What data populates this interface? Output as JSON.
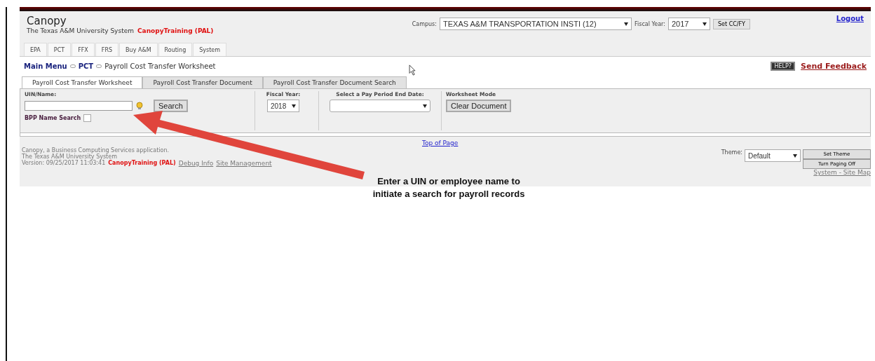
{
  "header": {
    "title": "Canopy",
    "org": "The Texas A&M University System",
    "environment": "CanopyTraining (PAL)",
    "campus": {
      "label": "Campus:",
      "value": "TEXAS A&M TRANSPORTATION INSTI (12)"
    },
    "fiscal_year": {
      "label": "Fiscal Year:",
      "value": "2017"
    },
    "set_button": "Set CC/FY",
    "logout": "Logout"
  },
  "nav_tabs": [
    {
      "label": "EPA"
    },
    {
      "label": "PCT"
    },
    {
      "label": "FFX"
    },
    {
      "label": "FRS"
    },
    {
      "label": "Buy A&M"
    },
    {
      "label": "Routing"
    },
    {
      "label": "System"
    }
  ],
  "breadcrumb": [
    {
      "label": "Main Menu",
      "kind": "link"
    },
    {
      "label": "PCT",
      "kind": "link"
    },
    {
      "label": "Payroll Cost Transfer Worksheet",
      "kind": "current"
    }
  ],
  "help_button": "HELP?",
  "feedback": "Send Feedback",
  "subtabs": [
    {
      "label": "Payroll Cost Transfer Worksheet",
      "selected": true
    },
    {
      "label": "Payroll Cost Transfer Document",
      "selected": false
    },
    {
      "label": "Payroll Cost Transfer Document Search",
      "selected": false
    }
  ],
  "form": {
    "uin_label": "UIN/Name:",
    "search_button": "Search",
    "bpp": {
      "label": "BPP Name Search",
      "checked": false
    },
    "fiscal_year": {
      "label": "Fiscal Year:",
      "value": "2018"
    },
    "pay_period": {
      "label": "Select a Pay Period End Date:"
    },
    "mode": {
      "label": "Worksheet Mode",
      "button": "Clear Document"
    }
  },
  "footer": {
    "line_1": "Canopy, a Business Computing Services application.",
    "line_2": "The Texas A&M University System",
    "version": "Version: 09/25/2017 11:03:41",
    "environment": "CanopyTraining (PAL)",
    "debug": "Debug Info",
    "site_management": "Site Management",
    "top_link": "Top of Page",
    "theme": {
      "label": "Theme:",
      "value": "Default"
    },
    "set_theme": "Set Theme",
    "paging": "Turn Paging Off",
    "site_map": "System - Site Map"
  },
  "callout": "Enter a UIN or employee name to initiate a search for payroll records"
}
